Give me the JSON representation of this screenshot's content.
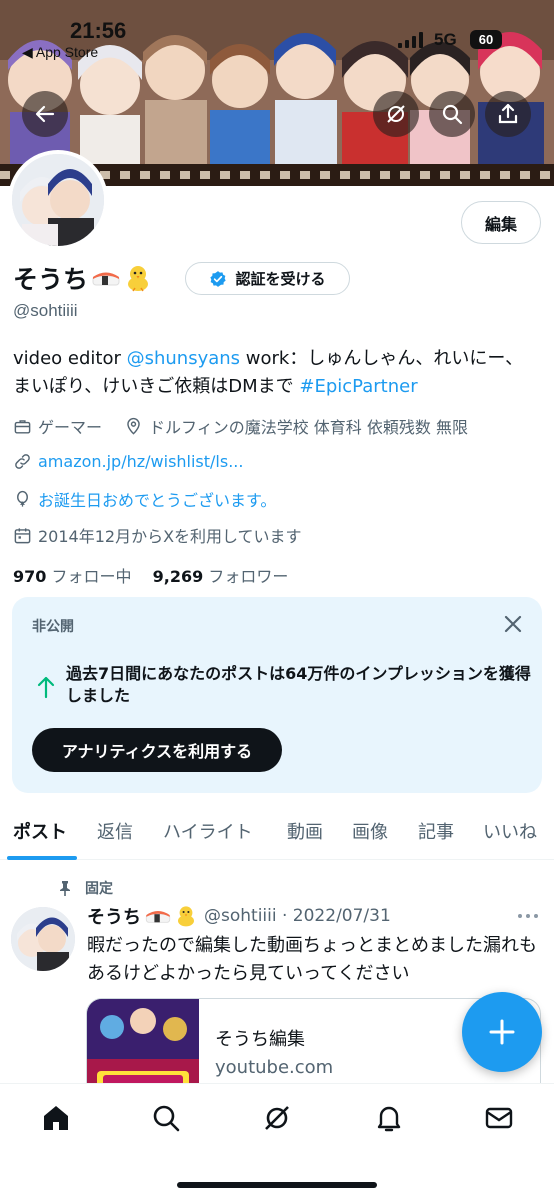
{
  "status_bar": {
    "time": "21:56",
    "back_app": "◀ App Store",
    "network": "5G",
    "battery": "60"
  },
  "profile": {
    "edit_label": "編集",
    "display_name": "そうち",
    "verify_label": "認証を受ける",
    "handle": "@sohtiiii",
    "bio": {
      "part1": "video editor ",
      "mention": "@shunsyans",
      "part2": " work：しゅんしゃん、れいにー、 まいぽり、けいきご依頼はDMまで ",
      "hashtag": "#EpicPartner"
    },
    "category": "ゲーマー",
    "location": "ドルフィンの魔法学校 体育科 依頼残数 無限",
    "website": "amazon.jp/hz/wishlist/ls...",
    "birthday": "お誕生日おめでとうございます。",
    "joined": "2014年12月からXを利用しています",
    "following_count": "970",
    "following_label": "フォロー中",
    "followers_count": "9,269",
    "followers_label": "フォロワー"
  },
  "private_card": {
    "label": "非公開",
    "message": "過去7日間にあなたのポストは64万件のインプレッションを獲得しました",
    "button": "アナリティクスを利用する"
  },
  "tabs": [
    "ポスト",
    "返信",
    "ハイライト",
    "動画",
    "画像",
    "記事",
    "いいね"
  ],
  "pinned_post": {
    "pinned_label": "固定",
    "name": "そうち",
    "meta": "@sohtiiii · 2022/07/31",
    "text": "暇だったので編集した動画ちょっとまとめました漏れもあるけどよかったら見ていってください",
    "link_title": "そうち編集",
    "link_domain": "youtube.com"
  },
  "colors": {
    "accent": "#1d9bf0",
    "text": "#0f1419",
    "secondary": "#536471",
    "card_bg": "#e8f5fd"
  },
  "icons": [
    "back-arrow-icon",
    "grok-icon",
    "search-icon",
    "share-icon",
    "verified-badge-icon",
    "briefcase-icon",
    "location-pin-icon",
    "link-icon",
    "balloon-icon",
    "calendar-icon",
    "close-icon",
    "arrow-up-icon",
    "pin-icon",
    "more-icon",
    "compose-plus-icon",
    "home-icon",
    "notifications-bell-icon",
    "messages-envelope-icon"
  ]
}
